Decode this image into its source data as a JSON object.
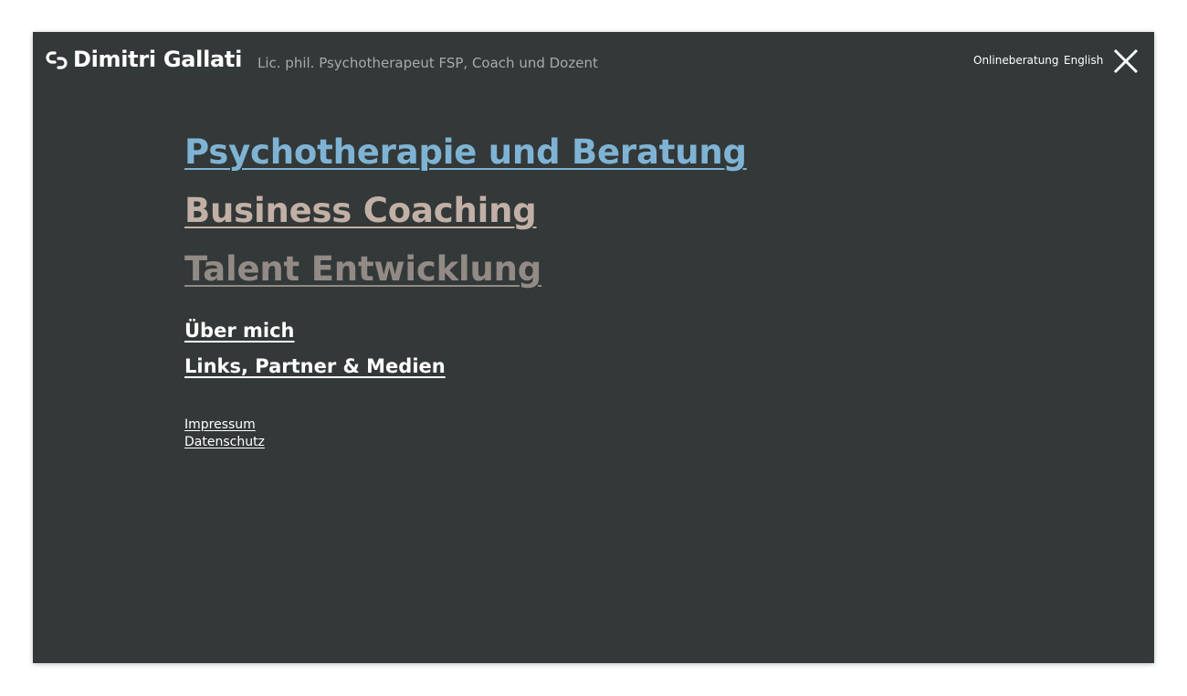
{
  "header": {
    "logo_icon": "dg-logo-icon",
    "brand_name": "Dimitri Gallati",
    "tagline": "Lic. phil. Psychotherapeut FSP, Coach und Dozent",
    "online_label": "Onlineberatung",
    "language_label": "English",
    "close_icon": "close-icon"
  },
  "menu": {
    "primary": [
      {
        "label": "Psychotherapie und Beratung",
        "color": "#7fb3d4"
      },
      {
        "label": "Business Coaching",
        "color": "#c2b0a6"
      },
      {
        "label": "Talent Entwicklung",
        "color": "#928a85"
      }
    ],
    "secondary": [
      {
        "label": "Über mich"
      },
      {
        "label": "Links, Partner & Medien"
      }
    ],
    "legal": [
      {
        "label": "Impressum"
      },
      {
        "label": "Datenschutz"
      }
    ]
  },
  "colors": {
    "background": "#333838",
    "text": "#ffffff",
    "tagline": "#a8abab"
  }
}
